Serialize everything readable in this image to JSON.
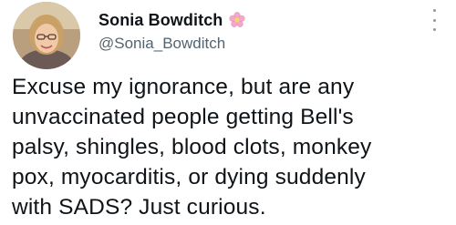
{
  "tweet": {
    "author": {
      "display_name": "Sonia Bowditch",
      "handle": "@Sonia_Bowditch",
      "name_emoji_icon": "pink-flower-icon",
      "avatar_icon": "avatar-photo"
    },
    "more_options_icon": "vertical-dots-icon",
    "text": "Excuse my ignorance, but are any\nunvaccinated people getting Bell's\npalsy, shingles, blood clots, monkey\npox, myocarditis, or dying suddenly\nwith SADS? Just curious."
  },
  "colors": {
    "text_primary": "#0f1419",
    "text_secondary": "#536471",
    "flower": "#f4a7c8",
    "background": "#ffffff"
  }
}
